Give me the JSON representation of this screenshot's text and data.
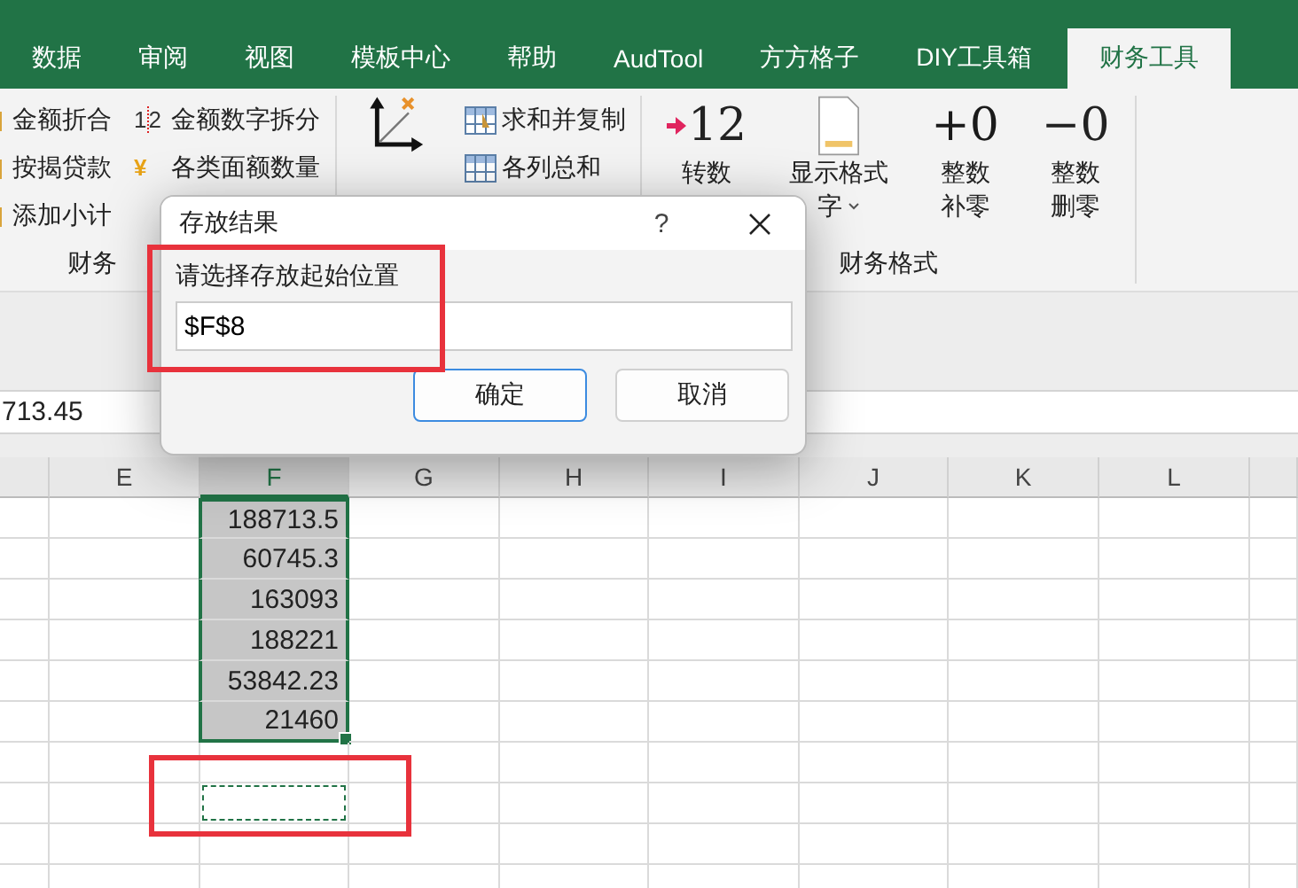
{
  "tabs": [
    {
      "label": "数据",
      "selected": false
    },
    {
      "label": "审阅",
      "selected": false
    },
    {
      "label": "视图",
      "selected": false
    },
    {
      "label": "模板中心",
      "selected": false
    },
    {
      "label": "帮助",
      "selected": false
    },
    {
      "label": "AudTool",
      "selected": false
    },
    {
      "label": "方方格子",
      "selected": false
    },
    {
      "label": "DIY工具箱",
      "selected": false
    },
    {
      "label": "财务工具",
      "selected": true
    }
  ],
  "ribbon": {
    "groups": [
      {
        "label": "财务",
        "items": [
          {
            "kind": "small",
            "text": "金额折合"
          },
          {
            "kind": "small",
            "text": "按揭贷款"
          },
          {
            "kind": "small",
            "text": "添加小计"
          },
          {
            "kind": "small",
            "glyph": [
              "1",
              "2"
            ],
            "text": "金额数字拆分"
          },
          {
            "kind": "small",
            "glyph": [
              "¥"
            ],
            "text": "各类面额数量"
          }
        ]
      },
      {
        "items": [
          {
            "kind": "big"
          },
          {
            "kind": "small",
            "text": "求和并复制"
          },
          {
            "kind": "small",
            "text": "各列总和"
          }
        ]
      },
      {
        "label": "财务格式",
        "items": [
          {
            "kind": "big",
            "glyph": [
              "12"
            ],
            "lines": [
              "转数"
            ]
          },
          {
            "kind": "big",
            "lines": [
              "显示格式",
              "字"
            ],
            "dropdown": true
          },
          {
            "kind": "big",
            "glyph": [
              "+0"
            ],
            "lines": [
              "整数",
              "补零"
            ]
          },
          {
            "kind": "big",
            "glyph": [
              "−0"
            ],
            "lines": [
              "整数",
              "删零"
            ]
          }
        ]
      }
    ]
  },
  "formula_bar": {
    "value": "713.45"
  },
  "sheet": {
    "columns": [
      {
        "label": "E",
        "selected": false
      },
      {
        "label": "F",
        "selected": true
      },
      {
        "label": "G",
        "selected": false
      },
      {
        "label": "H",
        "selected": false
      },
      {
        "label": "I",
        "selected": false
      },
      {
        "label": "J",
        "selected": false
      },
      {
        "label": "K",
        "selected": false
      },
      {
        "label": "L",
        "selected": false
      }
    ],
    "rows": [
      {
        "value": "188713.5",
        "selected": true
      },
      {
        "value": "60745.3",
        "selected": true
      },
      {
        "value": "163093",
        "selected": true
      },
      {
        "value": "188221",
        "selected": true
      },
      {
        "value": "53842.23",
        "selected": true
      },
      {
        "value": "21460",
        "selected": true
      },
      {
        "selected": false
      },
      {
        "selected": false,
        "marquee": true
      },
      {
        "selected": false
      },
      {
        "selected": false
      }
    ]
  },
  "dialog": {
    "title": "存放结果",
    "help": "?",
    "label": "请选择存放起始位置",
    "value": "$F$8",
    "buttons": [
      {
        "label": "确定",
        "default": true
      },
      {
        "label": "取消",
        "default": false
      }
    ]
  }
}
